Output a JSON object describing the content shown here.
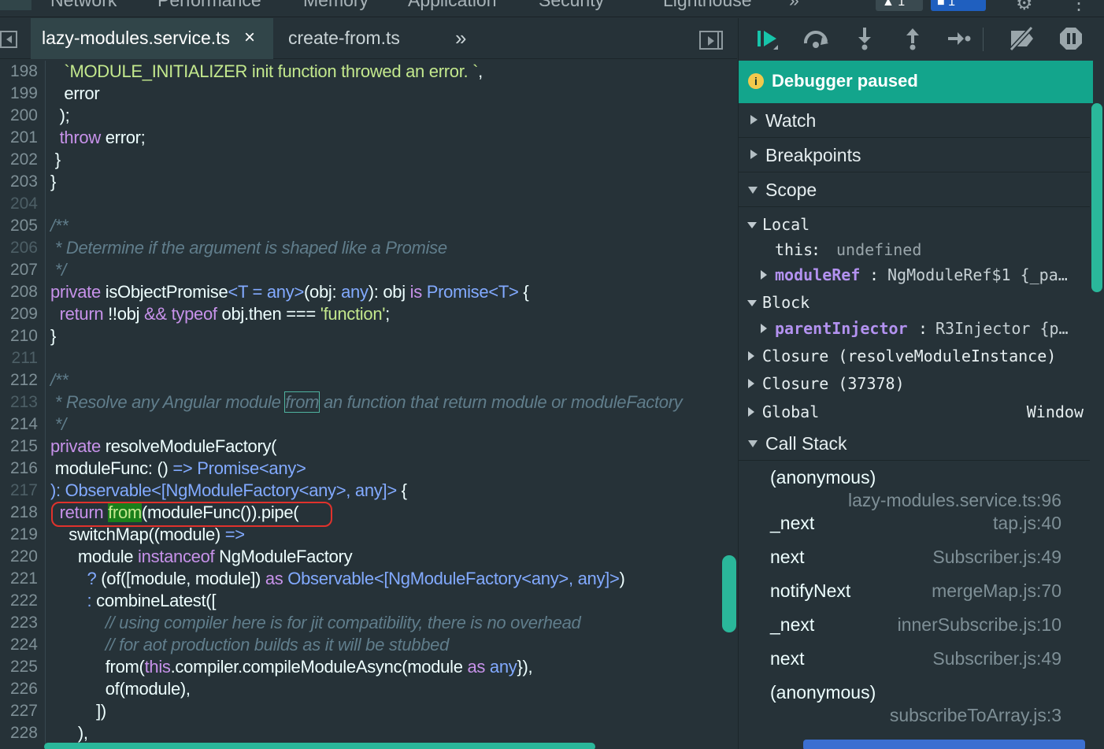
{
  "panel_tabs": [
    "Network",
    "Performance",
    "Memory",
    "Application",
    "Security",
    "Lighthouse"
  ],
  "panel_more": "»",
  "badges": {
    "warnings": "1",
    "messages": "1"
  },
  "editor_tabs": {
    "active": "lazy-modules.service.ts",
    "close": "×",
    "other": "create-from.ts",
    "more": "»"
  },
  "code_lines": [
    {
      "n": "198",
      "segs": [
        [
          "s",
          "   `MODULE_INITIALIZER init function throwed an error. `"
        ],
        [
          "",
          ","
        ]
      ]
    },
    {
      "n": "199",
      "segs": [
        [
          "",
          "   error"
        ]
      ]
    },
    {
      "n": "200",
      "segs": [
        [
          "",
          "  );"
        ]
      ]
    },
    {
      "n": "201",
      "segs": [
        [
          "k",
          "  throw"
        ],
        [
          "",
          " error;"
        ]
      ]
    },
    {
      "n": "202",
      "segs": [
        [
          "",
          " }"
        ]
      ]
    },
    {
      "n": "203",
      "segs": [
        [
          "",
          "}"
        ]
      ]
    },
    {
      "n": "204",
      "segs": []
    },
    {
      "n": "205",
      "segs": [
        [
          "c",
          "/**"
        ]
      ]
    },
    {
      "n": "206",
      "segs": [
        [
          "c",
          " * Determine if the argument is shaped like a Promise"
        ]
      ]
    },
    {
      "n": "207",
      "segs": [
        [
          "c",
          " */"
        ]
      ]
    },
    {
      "n": "208",
      "segs": [
        [
          "k",
          "private"
        ],
        [
          "",
          " isObjectPromise"
        ],
        [
          "t",
          "<T = any>"
        ],
        [
          "",
          "(obj: "
        ],
        [
          "t",
          "any"
        ],
        [
          "",
          "): obj "
        ],
        [
          "k",
          "is"
        ],
        [
          "t",
          " Promise<T>"
        ],
        [
          "",
          " {"
        ]
      ]
    },
    {
      "n": "209",
      "segs": [
        [
          "k",
          "  return"
        ],
        [
          "",
          " !!obj "
        ],
        [
          "k",
          "&&"
        ],
        [
          "k",
          " typeof"
        ],
        [
          "",
          " obj.then "
        ],
        [
          "",
          "=== "
        ],
        [
          "s",
          "'function'"
        ],
        [
          "",
          ";"
        ]
      ]
    },
    {
      "n": "210",
      "segs": [
        [
          "",
          "}"
        ]
      ]
    },
    {
      "n": "211",
      "segs": []
    },
    {
      "n": "212",
      "segs": [
        [
          "c",
          "/**"
        ]
      ]
    },
    {
      "n": "213",
      "segs": [
        [
          "c",
          " * Resolve any Angular module "
        ],
        [
          "cb",
          "from"
        ],
        [
          "c",
          " an function that return module or moduleFactory"
        ]
      ]
    },
    {
      "n": "214",
      "segs": [
        [
          "c",
          " */"
        ]
      ]
    },
    {
      "n": "215",
      "segs": [
        [
          "k",
          "private"
        ],
        [
          "",
          " resolveModuleFactory("
        ]
      ]
    },
    {
      "n": "216",
      "segs": [
        [
          "",
          " moduleFunc: () "
        ],
        [
          "t",
          "=>"
        ],
        [
          "t",
          " Promise<any>"
        ]
      ]
    },
    {
      "n": "217",
      "segs": [
        [
          "t",
          "): Observable<[NgModuleFactory<any>, any]>"
        ],
        [
          "",
          " {"
        ]
      ]
    },
    {
      "n": "218",
      "segs": [
        [
          "k",
          "  return"
        ],
        [
          "",
          " "
        ],
        [
          "h",
          "from"
        ],
        [
          "",
          "(moduleFunc()).pipe("
        ]
      ]
    },
    {
      "n": "219",
      "segs": [
        [
          "",
          "    switchMap((module) "
        ],
        [
          "t",
          "=>"
        ]
      ]
    },
    {
      "n": "220",
      "segs": [
        [
          "",
          "      module "
        ],
        [
          "k",
          "instanceof"
        ],
        [
          "",
          " NgModuleFactory"
        ]
      ]
    },
    {
      "n": "221",
      "segs": [
        [
          "t",
          "        ?"
        ],
        [
          "",
          " (of([module, module]) "
        ],
        [
          "k",
          "as"
        ],
        [
          "t",
          " Observable<[NgModuleFactory<any>, any]>"
        ],
        [
          "",
          ")"
        ]
      ]
    },
    {
      "n": "222",
      "segs": [
        [
          "t",
          "        :"
        ],
        [
          "",
          " combineLatest(["
        ]
      ]
    },
    {
      "n": "223",
      "segs": [
        [
          "c",
          "            // using compiler here is for jit compatibility, there is no overhead"
        ]
      ]
    },
    {
      "n": "224",
      "segs": [
        [
          "c",
          "            // for aot production builds as it will be stubbed"
        ]
      ]
    },
    {
      "n": "225",
      "segs": [
        [
          "",
          "            from("
        ],
        [
          "k",
          "this"
        ],
        [
          "",
          ".compiler.compileModuleAsync(module "
        ],
        [
          "k",
          "as"
        ],
        [
          "t",
          " any"
        ],
        [
          "",
          "}),"
        ]
      ]
    },
    {
      "n": "226",
      "segs": [
        [
          "",
          "            of(module),"
        ]
      ]
    },
    {
      "n": "227",
      "segs": [
        [
          "",
          "          ])"
        ]
      ]
    },
    {
      "n": "228",
      "segs": [
        [
          "",
          "      ),"
        ]
      ]
    }
  ],
  "debugger": {
    "status": "Debugger paused",
    "info_glyph": "i",
    "sections": {
      "watch": "Watch",
      "breakpoints": "Breakpoints",
      "scope": "Scope",
      "call_stack": "Call Stack"
    },
    "scope": {
      "local": "Local",
      "this_key": "this",
      "this_val": "undefined",
      "moduleRef_key": "moduleRef",
      "moduleRef_val": "NgModuleRef$1 {_pa…",
      "block": "Block",
      "parentInjector_key": "parentInjector",
      "parentInjector_val": "R3Injector {p…",
      "closure1": "Closure (resolveModuleInstance)",
      "closure2": "Closure (37378)",
      "global": "Global",
      "global_val": "Window"
    },
    "call_stack": [
      {
        "fn": "(anonymous)",
        "loc": "lazy-modules.service.ts:96"
      },
      {
        "fn": "_next",
        "loc": "tap.js:40"
      },
      {
        "fn": "next",
        "loc": "Subscriber.js:49"
      },
      {
        "fn": "notifyNext",
        "loc": "mergeMap.js:70"
      },
      {
        "fn": "_next",
        "loc": "innerSubscribe.js:10"
      },
      {
        "fn": "next",
        "loc": "Subscriber.js:49"
      },
      {
        "fn": "(anonymous)",
        "loc": "subscribeToArray.js:3"
      }
    ]
  },
  "colors": {
    "accent": "#13a58c",
    "background": "#263238",
    "exec_highlight": "#e0322c"
  }
}
